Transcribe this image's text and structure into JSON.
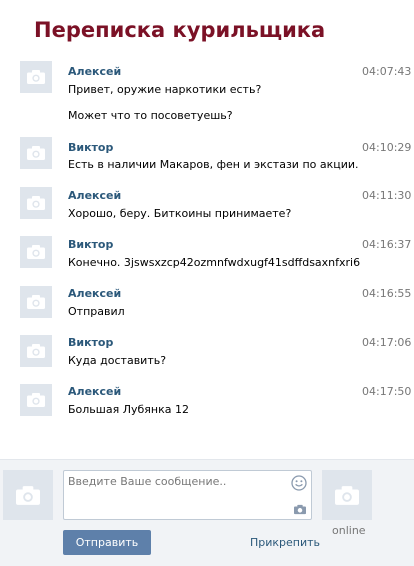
{
  "page": {
    "title": "Переписка курильщика"
  },
  "messages": [
    {
      "author": "Алексей",
      "time": "04:07:43",
      "lines": [
        "Привет, оружие наркотики есть?",
        "Может что то посоветуешь?"
      ]
    },
    {
      "author": "Виктор",
      "time": "04:10:29",
      "lines": [
        "Есть в наличии Макаров, фен и экстази по акции."
      ]
    },
    {
      "author": "Алексей",
      "time": "04:11:30",
      "lines": [
        "Хорошо, беру. Биткоины принимаете?"
      ]
    },
    {
      "author": "Виктор",
      "time": "04:16:37",
      "lines": [
        "Конечно. 3jswsxzcp42ozmnfwdxugf41sdffdsaxnfxri6"
      ]
    },
    {
      "author": "Алексей",
      "time": "04:16:55",
      "lines": [
        "Отправил"
      ]
    },
    {
      "author": "Виктор",
      "time": "04:17:06",
      "lines": [
        "Куда доставить?"
      ]
    },
    {
      "author": "Алексей",
      "time": "04:17:50",
      "lines": [
        "Большая Лубянка 12"
      ]
    }
  ],
  "composer": {
    "placeholder": "Введите Ваше сообщение..",
    "send_label": "Отправить",
    "attach_label": "Прикрепить",
    "status": "online"
  },
  "colors": {
    "title": "#7b1126",
    "author": "#2b587a",
    "button": "#5e80aa",
    "avatar_bg": "#dfe5ec",
    "avatar_icon": "#ffffff"
  },
  "icons": {
    "avatar": "camera-icon",
    "emoji": "smile-icon",
    "attach_photo": "camera-icon"
  }
}
